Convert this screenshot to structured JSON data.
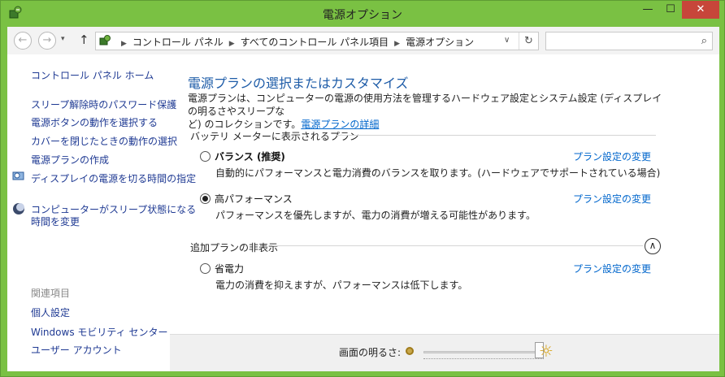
{
  "window": {
    "title": "電源オプション",
    "min_glyph": "—",
    "max_glyph": "☐",
    "close_glyph": "✕"
  },
  "nav": {
    "back_glyph": "←",
    "forward_glyph": "→",
    "recent_glyph": "▾",
    "up_glyph": "↑",
    "breadcrumbs": [
      "コントロール パネル",
      "すべてのコントロール パネル項目",
      "電源オプション"
    ],
    "crumb_sep": "▶",
    "dropdown_glyph": "∨",
    "refresh_glyph": "↻",
    "search_placeholder": "",
    "search_glyph": "⌕"
  },
  "help_glyph": "?",
  "sidebar": {
    "home": "コントロール パネル ホーム",
    "links": [
      "スリープ解除時のパスワード保護",
      "電源ボタンの動作を選択する",
      "カバーを閉じたときの動作の選択",
      "電源プランの作成",
      "ディスプレイの電源を切る時間の指定",
      "コンピューターがスリープ状態になる",
      "時間を変更"
    ],
    "related_heading": "関連項目",
    "related": [
      "個人設定",
      "Windows モビリティ センター",
      "ユーザー アカウント"
    ]
  },
  "main": {
    "title": "電源プランの選択またはカスタマイズ",
    "desc_line1": "電源プランは、コンピューターの電源の使用方法を管理するハードウェア設定とシステム設定 (ディスプレイの明るさやスリープな",
    "desc_line2": "ど) のコレクションです。",
    "desc_link": "電源プランの詳細",
    "battery_group": "バッテリ メーターに表示されるプラン",
    "hidden_group": "追加プランの非表示",
    "collapse_glyph": "∧",
    "plans": [
      {
        "name": "バランス (推奨)",
        "desc": "自動的にパフォーマンスと電力消費のバランスを取ります。(ハードウェアでサポートされている場合)",
        "link": "プラン設定の変更",
        "selected": false
      },
      {
        "name": "高パフォーマンス",
        "desc": "パフォーマンスを優先しますが、電力の消費が増える可能性があります。",
        "link": "プラン設定の変更",
        "selected": true
      },
      {
        "name": "省電力",
        "desc": "電力の消費を抑えますが、パフォーマンスは低下します。",
        "link": "プラン設定の変更",
        "selected": false
      }
    ]
  },
  "footer": {
    "brightness_label": "画面の明るさ:",
    "brightness_level": 1.0,
    "bright_glyph": "☼"
  },
  "colors": {
    "titlebar": "#7ac143",
    "link": "#0066cc",
    "heading": "#1e5ca8",
    "close": "#c7463a"
  }
}
